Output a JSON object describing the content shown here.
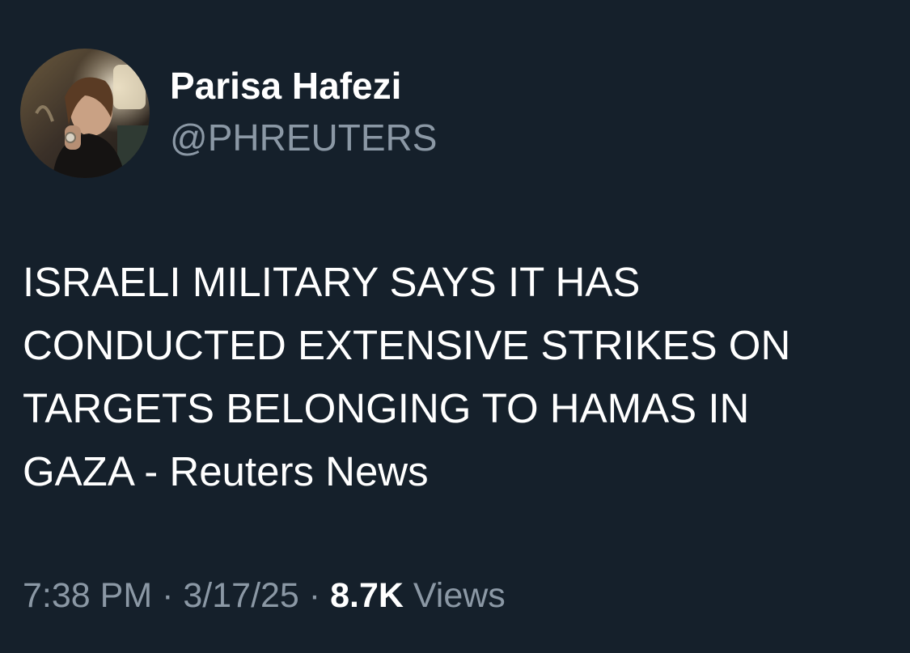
{
  "author": {
    "name": "Parisa Hafezi",
    "handle": "@PHREUTERS"
  },
  "tweet": {
    "lines": [
      "ISRAELI MILITARY SAYS IT HAS",
      "CONDUCTED EXTENSIVE STRIKES ON",
      "TARGETS BELONGING TO HAMAS IN",
      "GAZA - Reuters News"
    ]
  },
  "meta": {
    "time": "7:38 PM",
    "separator": "·",
    "date": "3/17/25",
    "views_count": "8.7K",
    "views_label": "Views"
  },
  "colors": {
    "background": "#15202b",
    "primary_text": "#ffffff",
    "secondary_text": "#8b98a5"
  }
}
